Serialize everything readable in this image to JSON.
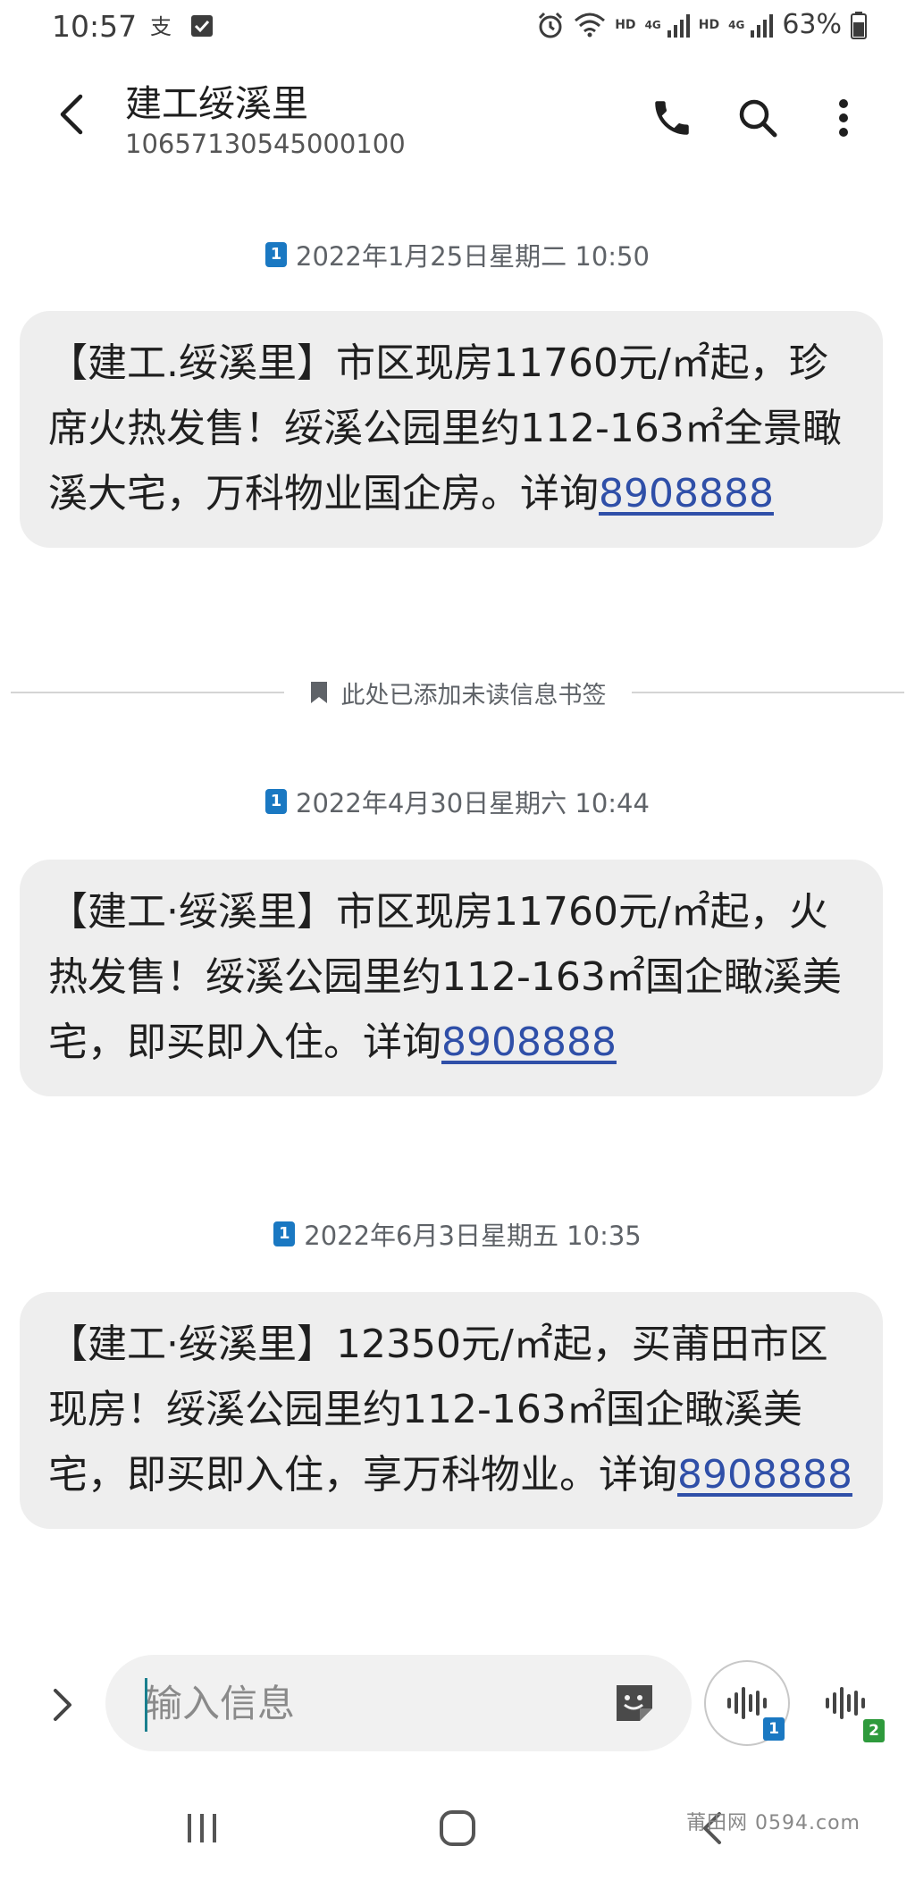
{
  "status_bar": {
    "time": "10:57",
    "battery": "63%",
    "hd_label": "HD",
    "network_label": "4G",
    "icons": [
      "alipay-icon",
      "checkbox-icon",
      "alarm-icon",
      "wifi-icon",
      "signal-icon",
      "battery-icon"
    ]
  },
  "header": {
    "contact_name": "建工绥溪里",
    "contact_number": "10657130545000100",
    "actions": [
      "call-icon",
      "search-icon",
      "more-icon"
    ]
  },
  "conversation": {
    "messages": [
      {
        "sim": "1",
        "date": "2022年1月25日星期二 10:50",
        "text": "【建工.绥溪里】市区现房11760元/㎡起，珍席火热发售！绥溪公园里约112-163㎡全景瞰溪大宅，万科物业国企房。详询",
        "link": "8908888"
      },
      {
        "sim": "1",
        "date": "2022年4月30日星期六 10:44",
        "text": "【建工·绥溪里】市区现房11760元/㎡起，火热发售！绥溪公园里约112-163㎡国企瞰溪美宅，即买即入住。详询",
        "link": "8908888"
      },
      {
        "sim": "1",
        "date": "2022年6月3日星期五 10:35",
        "text": "【建工·绥溪里】12350元/㎡起，买莆田市区现房！绥溪公园里约112-163㎡国企瞰溪美宅，即买即入住，享万科物业。详询",
        "link": "8908888"
      }
    ],
    "bookmark_divider": "此处已添加未读信息书签"
  },
  "input_bar": {
    "placeholder": "输入信息",
    "voice_sim1_badge": "1",
    "voice_sim2_badge": "2"
  },
  "colors": {
    "bubble_bg": "#eeeeee",
    "link": "#2f4fa8",
    "sim_badge": "#1a78c2",
    "sim2_badge": "#2e9a3c"
  },
  "watermark": "莆田网 0594.com"
}
